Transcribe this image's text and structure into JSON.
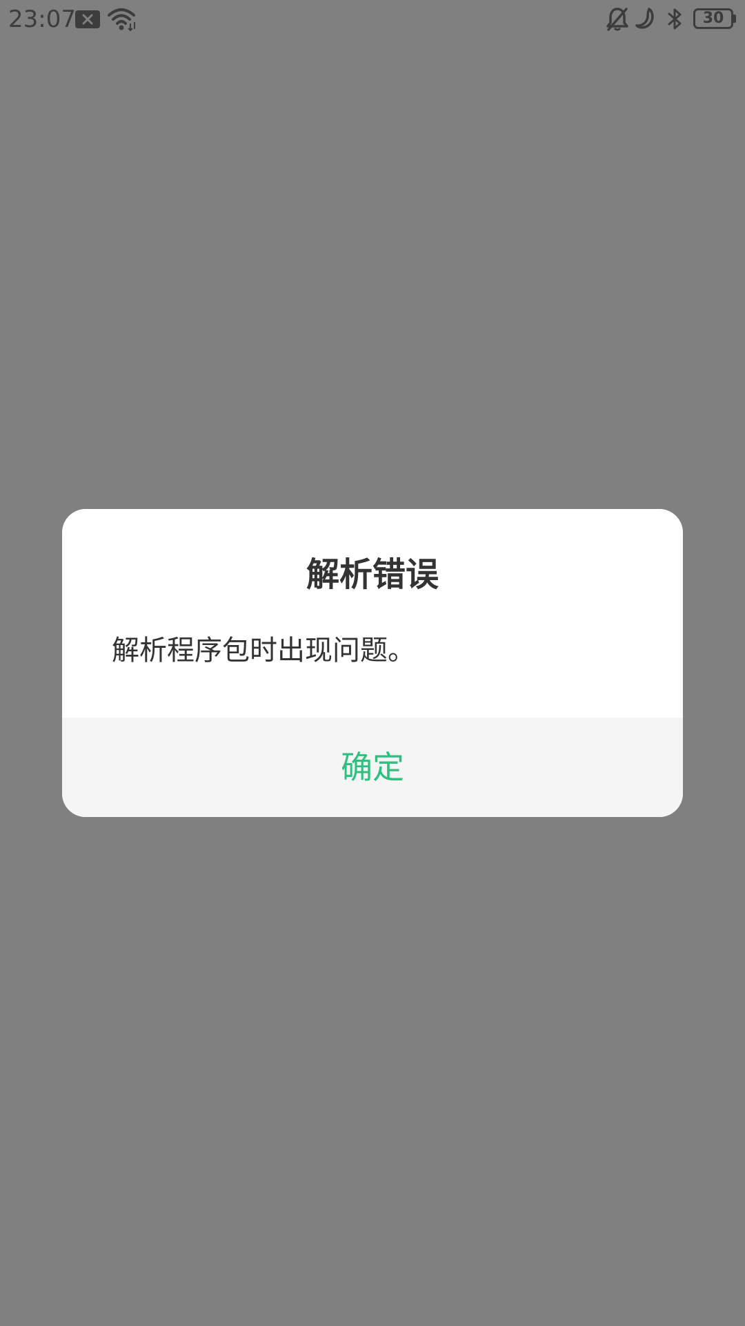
{
  "status_bar": {
    "time": "23:07",
    "battery_level": "30",
    "icons": [
      "notification-icon",
      "wifi-icon",
      "mute-icon",
      "do-not-disturb-icon",
      "bluetooth-icon",
      "battery-icon"
    ]
  },
  "dialog": {
    "title": "解析错误",
    "message": "解析程序包时出现问题。",
    "confirm_label": "确定",
    "accent_color": "#2fc07f"
  },
  "colors": {
    "scrim": "#808080",
    "dialog_background": "#ffffff",
    "footer_background": "#f5f5f5",
    "text": "#333333"
  }
}
